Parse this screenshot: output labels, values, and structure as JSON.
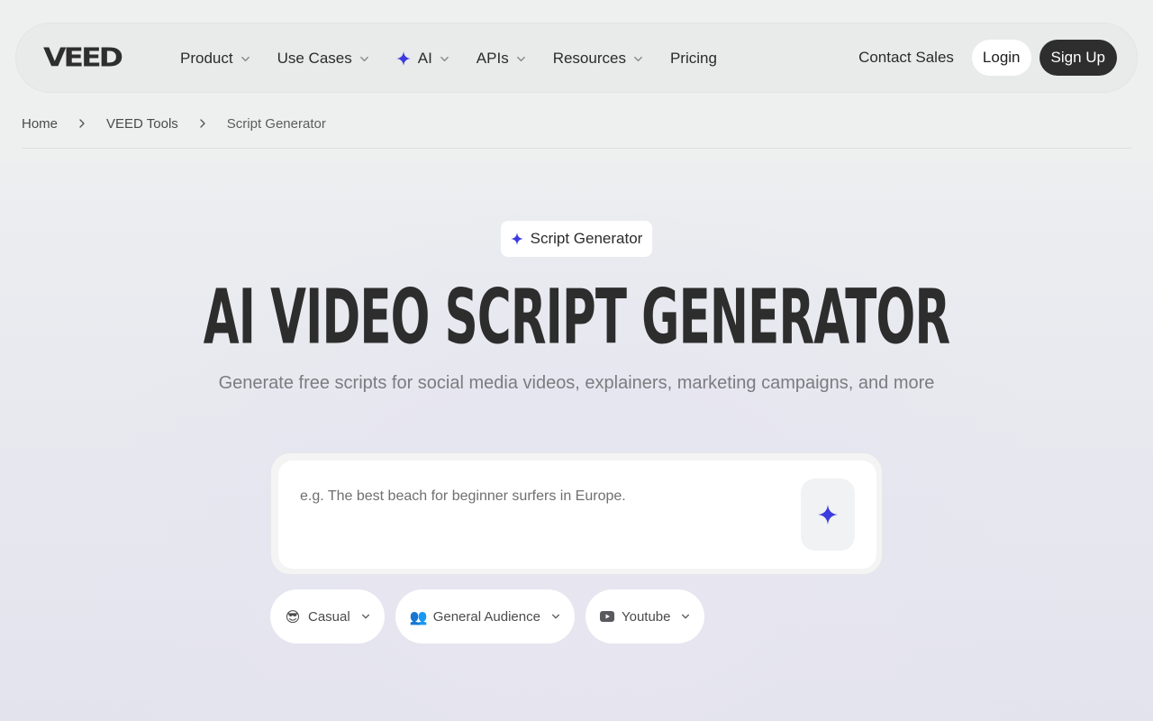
{
  "brand": {
    "logo_text": "VEED"
  },
  "nav": {
    "items": [
      {
        "label": "Product",
        "has_dropdown": true
      },
      {
        "label": "Use Cases",
        "has_dropdown": true
      },
      {
        "label": "AI",
        "has_dropdown": true,
        "icon": "sparkle-icon"
      },
      {
        "label": "APIs",
        "has_dropdown": true
      },
      {
        "label": "Resources",
        "has_dropdown": true
      },
      {
        "label": "Pricing",
        "has_dropdown": false
      }
    ],
    "contact_label": "Contact Sales",
    "login_label": "Login",
    "signup_label": "Sign Up"
  },
  "breadcrumb": {
    "items": [
      "Home",
      "VEED Tools",
      "Script Generator"
    ]
  },
  "hero": {
    "badge_label": "Script Generator",
    "title": "AI VIDEO SCRIPT GENERATOR",
    "subtitle": "Generate free scripts for social media videos, explainers, marketing campaigns, and more"
  },
  "prompt": {
    "value": "",
    "placeholder": "e.g. The best beach for beginner surfers in Europe."
  },
  "options": {
    "tone": {
      "emoji": "😎",
      "label": "Casual"
    },
    "audience": {
      "emoji": "👥",
      "label": "General Audience"
    },
    "platform": {
      "icon": "youtube-icon",
      "label": "Youtube"
    }
  },
  "colors": {
    "accent_sparkle": "#3b3bdf",
    "dark_button": "#2e2e2e",
    "page_bg": "#eef0ef"
  }
}
